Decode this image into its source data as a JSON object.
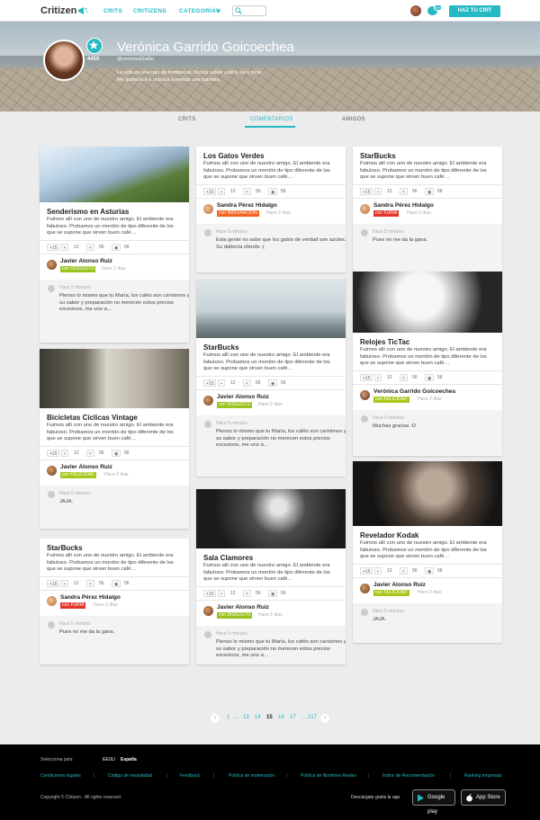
{
  "topbar": {
    "logo": "Critizen",
    "nav": [
      "CRITS",
      "CRITIZENS",
      "CATEGORÍAS"
    ],
    "notif_count": "99+",
    "cta": "HAZ TU CRIT"
  },
  "profile": {
    "name": "Verónica Garrido Goicoechea",
    "handle": "@veronicaGaGo",
    "score": "4450",
    "bio": [
      "La vida es una caja de bombones. Nunca sabes cuál te va a tocar.",
      "Me gustaría ir a una isla a pensar una palmera."
    ]
  },
  "tabs": [
    "CRITS",
    "COMENTARIOS",
    "AMIGOS"
  ],
  "cards": [
    {
      "title": "Senderismo en Asturias",
      "text": "Fuimos allí con uno de nuestro amigo. El ambiente era fabuloso. Probamos un montón de tipo diferente de los que se supone que sirven buen café…",
      "stats": [
        "+15",
        "12",
        "56",
        "56"
      ],
      "author": "Javier Alonso Ruiz",
      "mood": "con DISGUSTO",
      "ago": "Hace 2 días",
      "cago": "Hace 5 minutos",
      "comment": "Pienso lo mismo que tu María, los cafés son carísimos y su sabor y preparación no merecen estos precios excesivos, me uno a…"
    },
    {
      "title": "Bicicletas Cíclicas Vintage",
      "text": "Fuimos allí con uno de nuestro amigo. El ambiente era fabuloso. Probamos un montón de tipo diferente de los que se supone que sirven buen café…",
      "stats": [
        "+15",
        "12",
        "56",
        "56"
      ],
      "author": "Javier Alonso Ruiz",
      "mood": "con FELICIDAD",
      "ago": "Hace 2 días",
      "cago": "Hace 5 minutos",
      "comment": "JAJA."
    },
    {
      "title": "StarBucks",
      "text": "Fuimos allí con uno de nuestro amigo. El ambiente era fabuloso. Probamos un montón de tipo diferente de los que se supone que sirven buen café…",
      "stats": [
        "+15",
        "12",
        "56",
        "56"
      ],
      "author": "Sandra Pérez Hidalgo",
      "mood": "con FURIA",
      "ago": "Hace 2 días",
      "cago": "Hace 5 minutos",
      "comment": "Pues no me da la gana."
    },
    {
      "title": "Los Gatos Verdes",
      "text": "Fuimos allí con uno de nuestro amigo. El ambiente era fabuloso. Probamos un montón de tipo diferente de los que se supone que sirven buen café…",
      "stats": [
        "+15",
        "12",
        "56",
        "56"
      ],
      "author": "Sandra Pérez Hidalgo",
      "mood": "con INDIGNACIÓN",
      "ago": "Hace 2 días",
      "cago": "Hace 5 minutos",
      "comment": "Esta gente no sabe que los gatos de verdad son azules. Su daltonía ofende :("
    },
    {
      "title": "StarBucks",
      "text": "Fuimos allí con uno de nuestro amigo. El ambiente era fabuloso. Probamos un montón de tipo diferente de los que se supone que sirven buen café…",
      "stats": [
        "+15",
        "12",
        "56",
        "56"
      ],
      "author": "Javier Alonso Ruiz",
      "mood": "con DISGUSTO",
      "ago": "Hace 2 días",
      "cago": "Hace 5 minutos",
      "comment": "Pienso lo mismo que tu María, los cafés son carísimos y su sabor y preparación no merecen estos precios excesivos, me uno a…"
    },
    {
      "title": "Sala Clamores",
      "text": "Fuimos allí con uno de nuestro amigo. El ambiente era fabuloso. Probamos un montón de tipo diferente de los que se supone que sirven buen café…",
      "stats": [
        "+15",
        "12",
        "56",
        "56"
      ],
      "author": "Javier Alonso Ruiz",
      "mood": "con DISGUSTO",
      "ago": "Hace 2 días",
      "cago": "Hace 5 minutos",
      "comment": "Pienso lo mismo que tu María, los cafés son carísimos y su sabor y preparación no merecen estos precios excesivos, me uno a…"
    },
    {
      "title": "StarBucks",
      "text": "Fuimos allí con uno de nuestro amigo. El ambiente era fabuloso. Probamos un montón de tipo diferente de los que se supone que sirven buen café…",
      "stats": [
        "+15",
        "12",
        "56",
        "56"
      ],
      "author": "Sandra Pérez Hidalgo",
      "mood": "con FURIA",
      "ago": "Hace 2 días",
      "cago": "Hace 5 minutos",
      "comment": "Pues no me da la gana."
    },
    {
      "title": "Relojes TicTac",
      "text": "Fuimos allí con uno de nuestro amigo. El ambiente era fabuloso. Probamos un montón de tipo diferente de los que se supone que sirven buen café…",
      "stats": [
        "+15",
        "12",
        "56",
        "56"
      ],
      "author": "Verónica Garrido Goicoechea",
      "mood": "con FELICIDAD",
      "ago": "Hace 2 días",
      "cago": "Hace 5 minutos",
      "comment": "Muchas gracias :D"
    },
    {
      "title": "Revelador Kodak",
      "text": "Fuimos allí con uno de nuestro amigo. El ambiente era fabuloso. Probamos un montón de tipo diferente de los que se supone que sirven buen café…",
      "stats": [
        "+15",
        "12",
        "56",
        "56"
      ],
      "author": "Javier Alonso Ruiz",
      "mood": "con FELICIDAD",
      "ago": "Hace 2 días",
      "cago": "Hace 5 minutos",
      "comment": "JAJA."
    }
  ],
  "pagination": {
    "pages": [
      "1",
      "…",
      "13",
      "14",
      "15",
      "16",
      "17",
      "…",
      "217"
    ],
    "current": "15"
  },
  "footer": {
    "country_label": "Selecciona país:",
    "countries": [
      "EEUU",
      "España"
    ],
    "links": [
      "Condiciones legales",
      "Código de neutralidad",
      "Feedback",
      "Política de moderación",
      "Política de Nombres Reales",
      "Índice de Recomendación",
      "Ranking empresas"
    ],
    "copyright": "Copyright © Critizen - All rights reserved",
    "download": "Descárgate gratis la app",
    "stores": [
      "Google play",
      "App Store"
    ]
  },
  "colors": {
    "accent": "#25b9c4",
    "disgusto": "#9bc21f",
    "felicidad": "#a7c81a",
    "furia": "#e2342a",
    "indignacion": "#f2631e"
  }
}
